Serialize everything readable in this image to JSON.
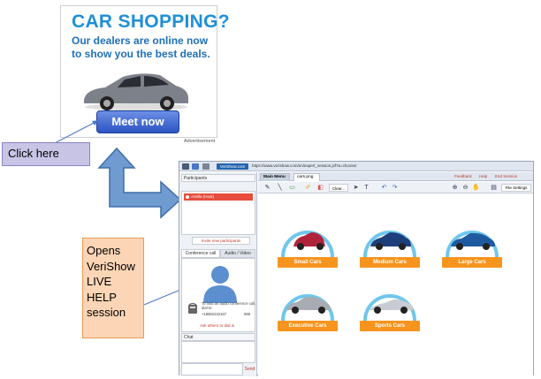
{
  "ad": {
    "title": "CAR SHOPPING?",
    "subtitle": "Our dealers are online now to show you the best deals.",
    "button": "Meet now",
    "caption": "Advertisement"
  },
  "callouts": {
    "click_here": "Click here",
    "opens_lines": [
      "Opens",
      "VeriShow",
      "LIVE",
      "HELP",
      "session"
    ]
  },
  "app": {
    "brand": "VeriShow.com",
    "url": "https://www.verishow.com/en/expert_session.jsf?a=chooser",
    "participants_header": "Participants",
    "participant_name": "Ariella (Host)",
    "invite": "Invite new participants",
    "tabs": [
      "Conference call",
      "Audio / Video"
    ],
    "conf_text": "To hold an audio conference call, dial-in:",
    "conf_number": "+18882232187",
    "conf_code": "688",
    "ask_dial": "Ask others to dial in",
    "chat_header": "Chat",
    "send": "Send",
    "main_tabs": [
      "Main Menu",
      "cars.png"
    ],
    "links": {
      "feedback": "Feedback",
      "help": "Help",
      "end": "End Session"
    },
    "clear": "Clear...",
    "file_settings": "File Settings",
    "cars": [
      {
        "label": "Small Cars",
        "color": "#b0243b"
      },
      {
        "label": "Medium Cars",
        "color": "#1d3f7a"
      },
      {
        "label": "Large Cars",
        "color": "#1e5aa0"
      },
      {
        "label": "Executive Cars",
        "color": "#a7acb3"
      },
      {
        "label": "Sports Cars",
        "color": "#c8ccd2"
      }
    ]
  },
  "colors": {
    "accent_orange": "#f7941d",
    "ring_blue": "#6fc6ee",
    "arrow_fill": "#6f9bd1"
  }
}
